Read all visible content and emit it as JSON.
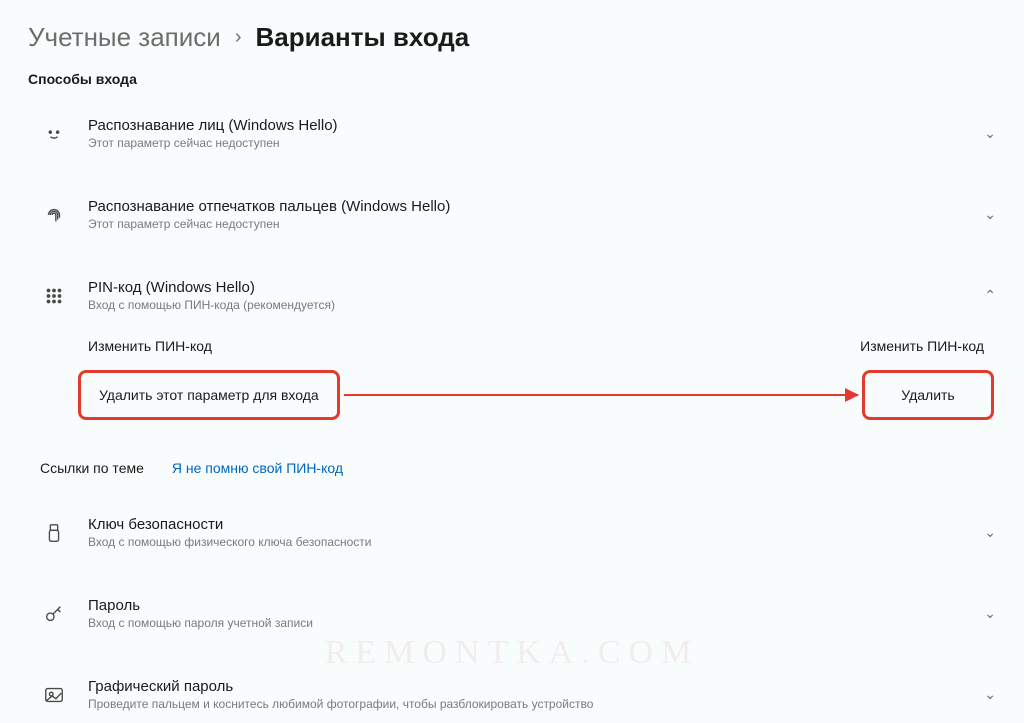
{
  "breadcrumb": {
    "parent": "Учетные записи",
    "current": "Варианты входа"
  },
  "section_title": "Способы входа",
  "options": {
    "face": {
      "title": "Распознавание лиц (Windows Hello)",
      "sub": "Этот параметр сейчас недоступен"
    },
    "finger": {
      "title": "Распознавание отпечатков пальцев (Windows Hello)",
      "sub": "Этот параметр сейчас недоступен"
    },
    "pin": {
      "title": "PIN-код (Windows Hello)",
      "sub": "Вход с помощью ПИН-кода (рекомендуется)"
    },
    "key": {
      "title": "Ключ безопасности",
      "sub": "Вход с помощью физического ключа безопасности"
    },
    "password": {
      "title": "Пароль",
      "sub": "Вход с помощью пароля учетной записи"
    },
    "picture": {
      "title": "Графический пароль",
      "sub": "Проведите пальцем и коснитесь любимой фотографии, чтобы разблокировать устройство"
    }
  },
  "pin_panel": {
    "change_label_left": "Изменить ПИН-код",
    "change_label_right": "Изменить ПИН-код",
    "remove_label": "Удалить этот параметр для входа",
    "remove_button": "Удалить"
  },
  "links": {
    "heading": "Ссылки по теме",
    "forgot_pin": "Я не помню свой ПИН-код"
  },
  "watermark": "REMONTKA.COM"
}
